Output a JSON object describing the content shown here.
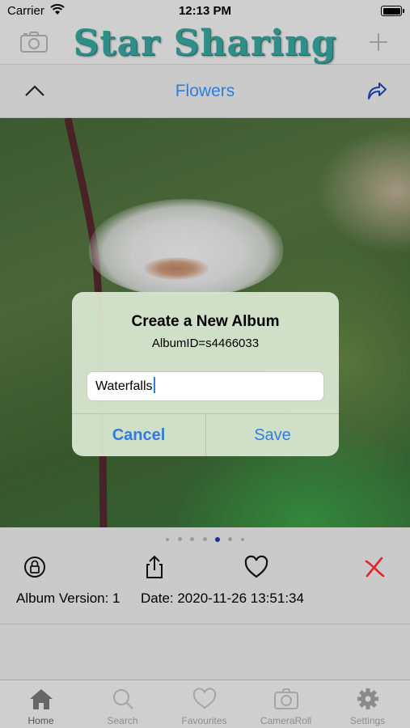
{
  "status_bar": {
    "carrier": "Carrier",
    "time": "12:13 PM"
  },
  "header": {
    "app_title": "Star Sharing",
    "left_icon": "camera-icon",
    "right_icon": "plus-icon"
  },
  "nav": {
    "album_title": "Flowers",
    "left_icon": "chevron-up-icon",
    "right_icon": "share-arrow-icon"
  },
  "alert": {
    "title": "Create a New Album",
    "message": "AlbumID=s4466033",
    "input_value": "Waterfalls",
    "cancel_label": "Cancel",
    "save_label": "Save"
  },
  "pager": {
    "count": 6,
    "active_index": 4
  },
  "photo_info": {
    "version_text": "Album Version: 1",
    "date_text": "Date: 2020-11-26 13:51:34",
    "delete_color": "#e0262b"
  },
  "tabs": [
    {
      "label": "Home",
      "icon": "home-icon",
      "active": true
    },
    {
      "label": "Search",
      "icon": "search-icon",
      "active": false
    },
    {
      "label": "Favourites",
      "icon": "heart-icon",
      "active": false
    },
    {
      "label": "CameraRoll",
      "icon": "camera-icon",
      "active": false
    },
    {
      "label": "Settings",
      "icon": "gear-icon",
      "active": false
    }
  ],
  "colors": {
    "accent": "#2f7de0",
    "title_teal": "#2f8f88",
    "pager_active": "#1f2f8a"
  }
}
